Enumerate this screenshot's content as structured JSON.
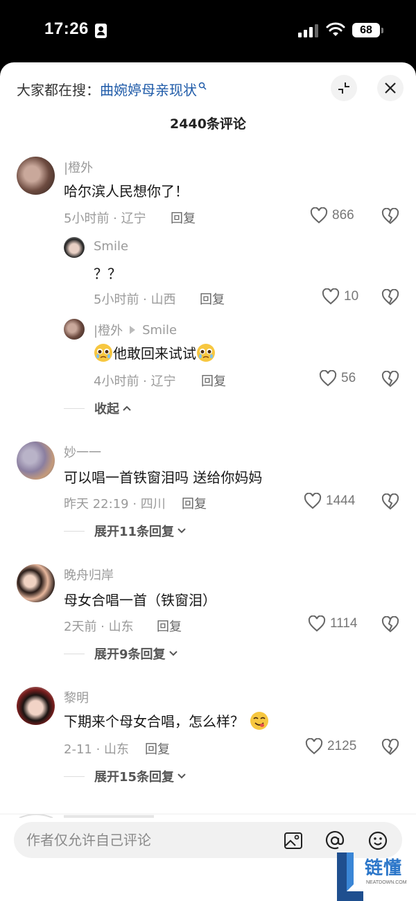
{
  "status_bar": {
    "time": "17:26",
    "battery": "68"
  },
  "header": {
    "search_prefix": "大家都在搜：",
    "search_term": "曲婉婷母亲现状",
    "comment_count": "2440条评论"
  },
  "comments": [
    {
      "user": "|橙外",
      "text": "哈尔滨人民想你了！",
      "time_loc": "5小时前 · 辽宁",
      "reply": "回复",
      "likes": "866",
      "replies": [
        {
          "user": "Smile",
          "text": "？？",
          "time_loc": "5小时前 · 山西",
          "reply": "回复",
          "likes": "10"
        },
        {
          "user": "|橙外",
          "to": "Smile",
          "text": "他敢回来试试",
          "time_loc": "4小时前 · 辽宁",
          "reply": "回复",
          "likes": "56"
        }
      ],
      "toggle": "收起"
    },
    {
      "user": "妙一一",
      "text": "可以唱一首铁窗泪吗 送给你妈妈",
      "time_loc": "昨天 22:19 · 四川",
      "reply": "回复",
      "likes": "1444",
      "toggle": "展开11条回复"
    },
    {
      "user": "晚舟归岸",
      "text": "母女合唱一首（铁窗泪）",
      "time_loc": "2天前 · 山东",
      "reply": "回复",
      "likes": "1114",
      "toggle": "展开9条回复"
    },
    {
      "user": "黎明",
      "text": "下期来个母女合唱，怎么样？",
      "time_loc": "2-11 · 山东",
      "reply": "回复",
      "likes": "2125",
      "toggle": "展开15条回复"
    }
  ],
  "input": {
    "placeholder": "作者仅允许自己评论"
  },
  "watermark": {
    "text": "链懂",
    "sub": "NEATDOWN.COM"
  },
  "colors": {
    "link": "#1e5aa8",
    "meta": "#9a9a9a",
    "watermark": "#2b76c9"
  }
}
